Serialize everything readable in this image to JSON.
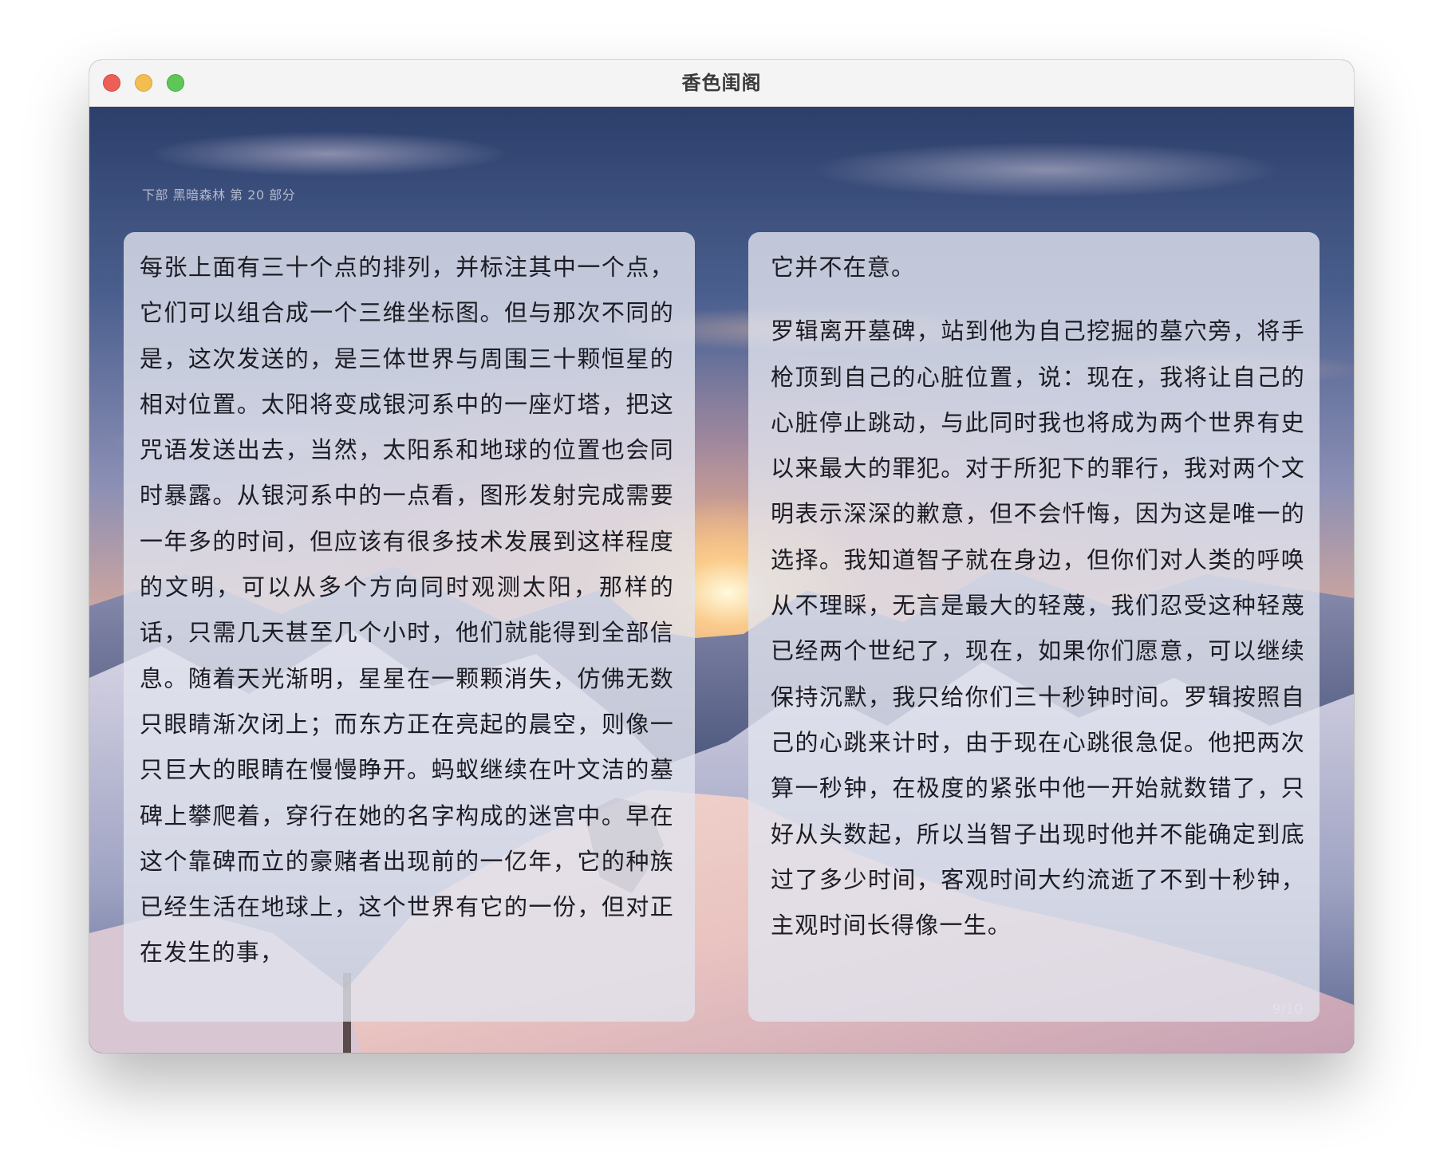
{
  "window": {
    "title": "香色闺阁"
  },
  "reader": {
    "chapter": "下部 黑暗森林 第 20 部分",
    "page_indicator": "9/10",
    "left_page": {
      "paragraphs": [
        "每张上面有三十个点的排列，并标注其中一个点，它们可以组合成一个三维坐标图。但与那次不同的是，这次发送的，是三体世界与周围三十颗恒星的相对位置。太阳将变成银河系中的一座灯塔，把这咒语发送出去，当然，太阳系和地球的位置也会同时暴露。从银河系中的一点看，图形发射完成需要一年多的时间，但应该有很多技术发展到这样程度的文明，可以从多个方向同时观测太阳，那样的话，只需几天甚至几个小时，他们就能得到全部信息。随着天光渐明，星星在一颗颗消失，仿佛无数只眼睛渐次闭上；而东方正在亮起的晨空，则像一只巨大的眼睛在慢慢睁开。蚂蚁继续在叶文洁的墓碑上攀爬着，穿行在她的名字构成的迷宫中。早在这个靠碑而立的豪赌者出现前的一亿年，它的种族已经生活在地球上，这个世界有它的一份，但对正在发生的事，"
      ]
    },
    "right_page": {
      "paragraphs": [
        "它并不在意。",
        "罗辑离开墓碑，站到他为自己挖掘的墓穴旁，将手枪顶到自己的心脏位置，说：现在，我将让自己的心脏停止跳动，与此同时我也将成为两个世界有史以来最大的罪犯。对于所犯下的罪行，我对两个文明表示深深的歉意，但不会忏悔，因为这是唯一的选择。我知道智子就在身边，但你们对人类的呼唤从不理睬，无言是最大的轻蔑，我们忍受这种轻蔑已经两个世纪了，现在，如果你们愿意，可以继续保持沉默，我只给你们三十秒钟时间。罗辑按照自己的心跳来计时，由于现在心跳很急促。他把两次算一秒钟，在极度的紧张中他一开始就数错了，只好从头数起，所以当智子出现时他并不能确定到底过了多少时间，客观时间大约流逝了不到十秒钟，主观时间长得像一生。"
      ]
    }
  }
}
